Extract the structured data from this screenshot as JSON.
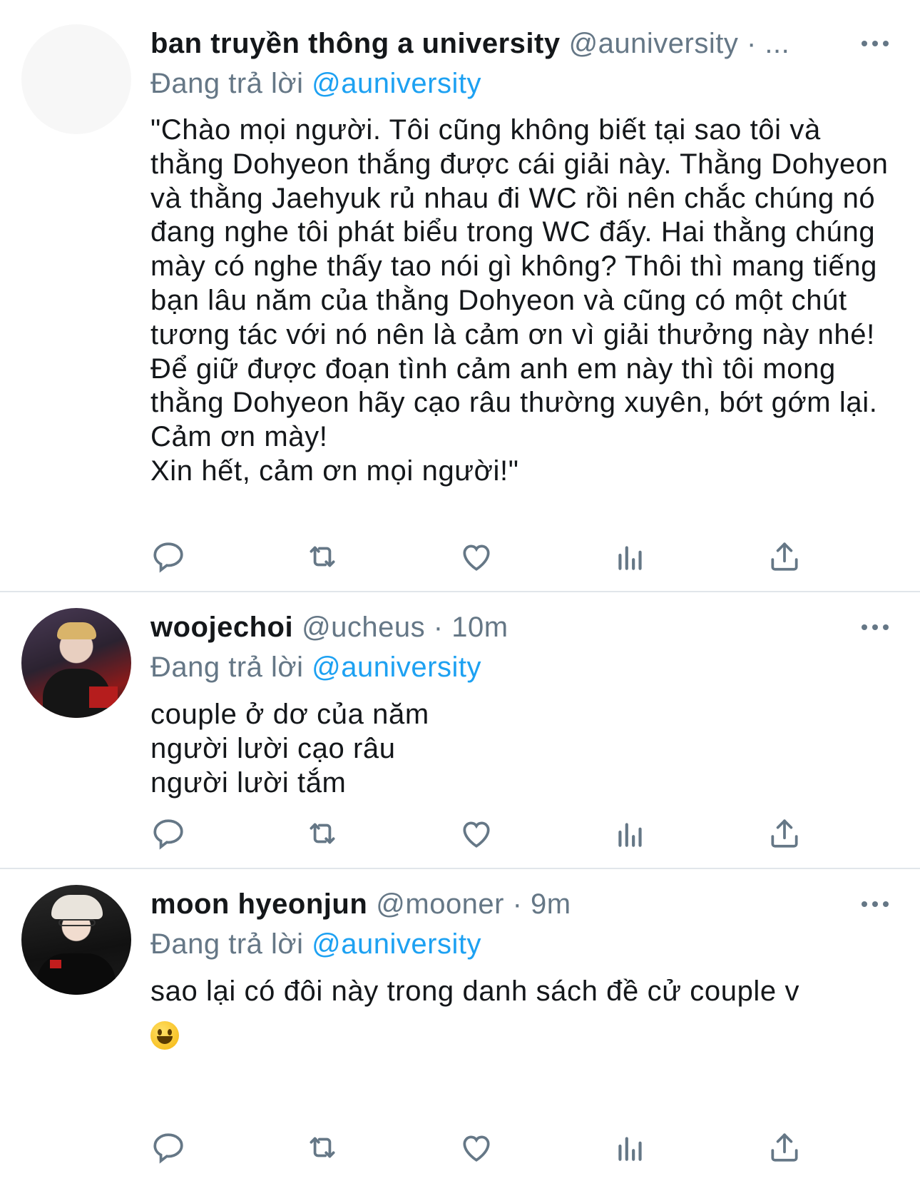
{
  "tweets": [
    {
      "name": "ban truyền thông a university",
      "meta": "@auniversity · ...",
      "reply_prefix": "Đang trả lời",
      "reply_handle": "@auniversity",
      "lines": [
        "\"Chào mọi người. Tôi cũng không biết tại sao tôi và thằng Dohyeon thắng được cái giải này. Thằng Dohyeon và thằng Jaehyuk rủ nhau đi WC rồi nên chắc chúng nó đang nghe tôi phát biểu trong WC đấy. Hai thằng chúng mày có nghe thấy tao nói gì không? Thôi thì mang tiếng bạn lâu năm của thằng Dohyeon và cũng có một chút tương tác với nó nên là cảm ơn vì giải thưởng này nhé!",
        "Để giữ được đoạn tình cảm anh em này thì tôi mong thằng Dohyeon hãy cạo râu thường xuyên, bớt gớm lại. Cảm ơn mày!",
        "Xin hết, cảm ơn mọi người!\""
      ]
    },
    {
      "name": "woojechoi",
      "meta": "@ucheus · 10m",
      "reply_prefix": "Đang trả lời",
      "reply_handle": "@auniversity",
      "lines": [
        "couple ở dơ của năm",
        "người lười cạo râu",
        "người lười tắm"
      ]
    },
    {
      "name": "moon hyeonjun",
      "meta": "@mooner · 9m",
      "reply_prefix": "Đang trả lời",
      "reply_handle": "@auniversity",
      "lines": [
        "sao lại có đôi này trong danh sách đề cử couple v"
      ],
      "emoji": "grinning-face-emoji"
    }
  ],
  "icons": {
    "reply": "reply-icon",
    "retweet": "retweet-icon",
    "like": "like-icon",
    "analytics": "analytics-icon",
    "share": "share-icon",
    "more": "more-icon"
  },
  "colors": {
    "link": "#1da1f2",
    "secondary": "#657786",
    "text": "#14171a",
    "divider": "#e1e6ea"
  }
}
